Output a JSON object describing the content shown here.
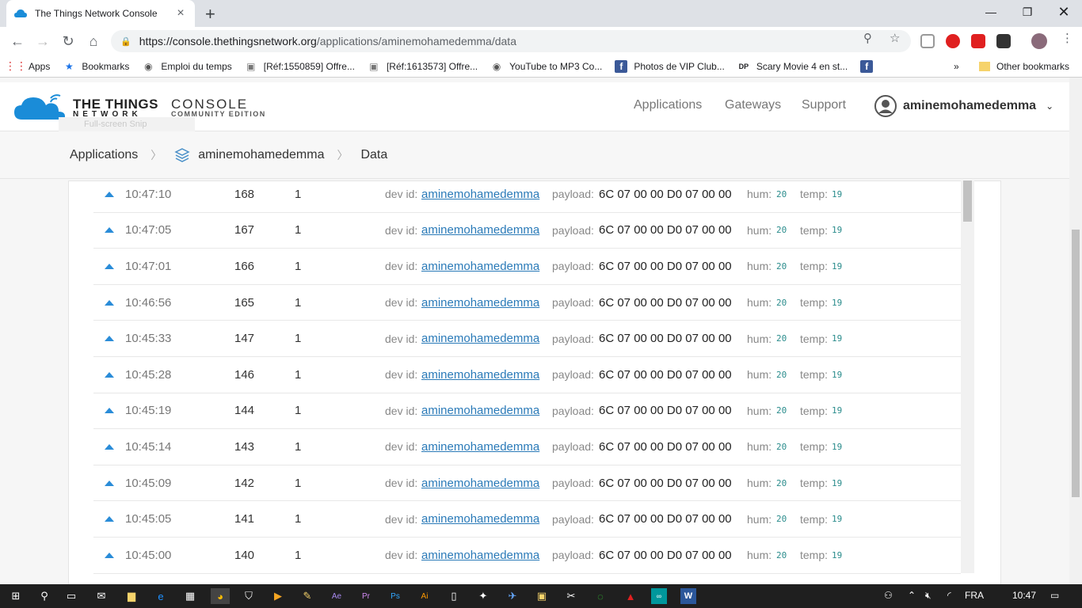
{
  "browser": {
    "tab_title": "The Things Network Console",
    "url_host": "https://console.thethingsnetwork.org",
    "url_path": "/applications/aminemohamedemma/data",
    "bookmarks": [
      "Apps",
      "Bookmarks",
      "Emploi du temps",
      "[Réf:1550859] Offre...",
      "[Réf:1613573] Offre...",
      "YouTube to MP3 Co...",
      "Photos de VIP Club...",
      "Scary Movie 4 en st..."
    ],
    "more_bookmarks": "»",
    "other_bookmarks": "Other bookmarks"
  },
  "header": {
    "brand_line1": "THE THINGS",
    "brand_line2": "NETWORK",
    "console_line1": "CONSOLE",
    "console_line2": "COMMUNITY EDITION",
    "snip_hint": "Full-screen Snip",
    "nav": [
      "Applications",
      "Gateways",
      "Support"
    ],
    "username": "aminemohamedemma"
  },
  "breadcrumbs": {
    "root": "Applications",
    "app": "aminemohamedemma",
    "current": "Data"
  },
  "labels": {
    "dev_id": "dev id:",
    "payload": "payload:",
    "hum": "hum:",
    "temp": "temp:"
  },
  "rows": [
    {
      "time": "10:47:10",
      "counter": "168",
      "port": "1",
      "dev_id": "aminemohamedemma",
      "payload": "6C 07 00 00 D0 07 00 00",
      "hum": "20",
      "temp": "19"
    },
    {
      "time": "10:47:05",
      "counter": "167",
      "port": "1",
      "dev_id": "aminemohamedemma",
      "payload": "6C 07 00 00 D0 07 00 00",
      "hum": "20",
      "temp": "19"
    },
    {
      "time": "10:47:01",
      "counter": "166",
      "port": "1",
      "dev_id": "aminemohamedemma",
      "payload": "6C 07 00 00 D0 07 00 00",
      "hum": "20",
      "temp": "19"
    },
    {
      "time": "10:46:56",
      "counter": "165",
      "port": "1",
      "dev_id": "aminemohamedemma",
      "payload": "6C 07 00 00 D0 07 00 00",
      "hum": "20",
      "temp": "19"
    },
    {
      "time": "10:45:33",
      "counter": "147",
      "port": "1",
      "dev_id": "aminemohamedemma",
      "payload": "6C 07 00 00 D0 07 00 00",
      "hum": "20",
      "temp": "19"
    },
    {
      "time": "10:45:28",
      "counter": "146",
      "port": "1",
      "dev_id": "aminemohamedemma",
      "payload": "6C 07 00 00 D0 07 00 00",
      "hum": "20",
      "temp": "19"
    },
    {
      "time": "10:45:19",
      "counter": "144",
      "port": "1",
      "dev_id": "aminemohamedemma",
      "payload": "6C 07 00 00 D0 07 00 00",
      "hum": "20",
      "temp": "19"
    },
    {
      "time": "10:45:14",
      "counter": "143",
      "port": "1",
      "dev_id": "aminemohamedemma",
      "payload": "6C 07 00 00 D0 07 00 00",
      "hum": "20",
      "temp": "19"
    },
    {
      "time": "10:45:09",
      "counter": "142",
      "port": "1",
      "dev_id": "aminemohamedemma",
      "payload": "6C 07 00 00 D0 07 00 00",
      "hum": "20",
      "temp": "19"
    },
    {
      "time": "10:45:05",
      "counter": "141",
      "port": "1",
      "dev_id": "aminemohamedemma",
      "payload": "6C 07 00 00 D0 07 00 00",
      "hum": "20",
      "temp": "19"
    },
    {
      "time": "10:45:00",
      "counter": "140",
      "port": "1",
      "dev_id": "aminemohamedemma",
      "payload": "6C 07 00 00 D0 07 00 00",
      "hum": "20",
      "temp": "19"
    }
  ],
  "taskbar": {
    "language": "FRA",
    "clock": "10:47"
  },
  "colors": {
    "uplink_arrow": "#2a8cd8",
    "link": "#2a7ab8",
    "field_value": "#2a8c8c"
  }
}
